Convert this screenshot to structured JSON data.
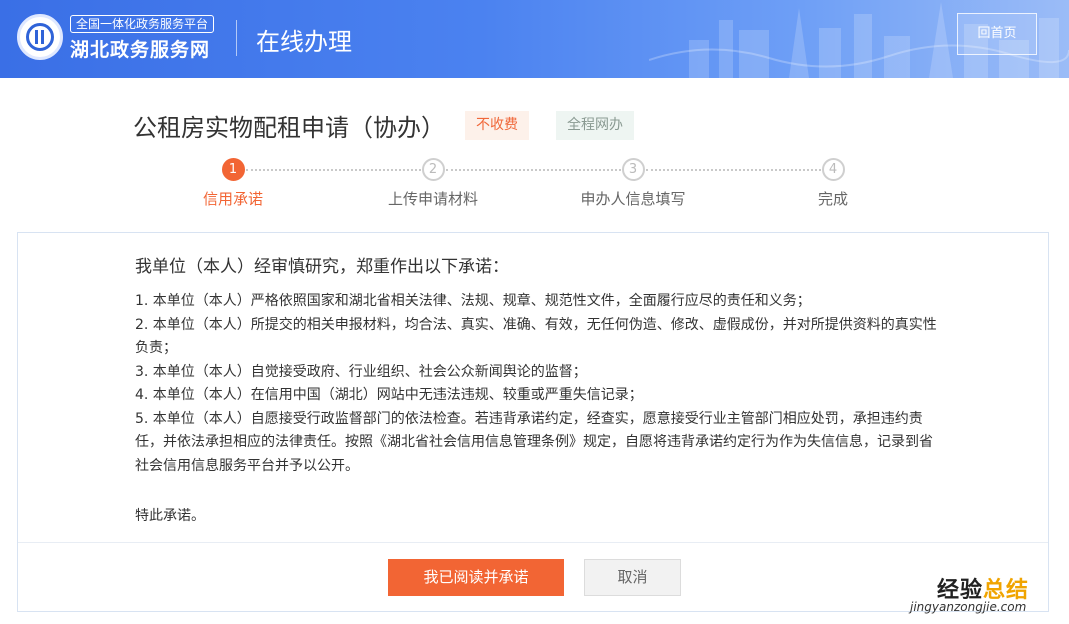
{
  "header": {
    "logo_top": "全国一体化政务服务平台",
    "logo_main": "湖北政务服务网",
    "section_title": "在线办理",
    "home_button": "回首页",
    "colors": {
      "start": "#3a6fe6",
      "end": "#9bbcf7"
    }
  },
  "service": {
    "title": "公租房实物配租申请（协办）",
    "tags": [
      "不收费",
      "全程网办"
    ]
  },
  "steps": [
    {
      "number": "1",
      "label": "信用承诺",
      "active": true
    },
    {
      "number": "2",
      "label": "上传申请材料",
      "active": false
    },
    {
      "number": "3",
      "label": "申办人信息填写",
      "active": false
    },
    {
      "number": "4",
      "label": "完成",
      "active": false
    }
  ],
  "pledge": {
    "title": "我单位（本人）经审慎研究，郑重作出以下承诺：",
    "items": [
      "1. 本单位（本人）严格依照国家和湖北省相关法律、法规、规章、规范性文件，全面履行应尽的责任和义务；",
      "2. 本单位（本人）所提交的相关申报材料，均合法、真实、准确、有效，无任何伪造、修改、虚假成份，并对所提供资料的真实性负责；",
      "3. 本单位（本人）自觉接受政府、行业组织、社会公众新闻舆论的监督；",
      "4. 本单位（本人）在信用中国（湖北）网站中无违法违规、较重或严重失信记录；",
      "5. 本单位（本人）自愿接受行政监督部门的依法检查。若违背承诺约定，经查实，愿意接受行业主管部门相应处罚，承担违约责任，并依法承担相应的法律责任。按照《湖北省社会信用信息管理条例》规定，自愿将违背承诺约定行为作为失信信息，记录到省社会信用信息服务平台并予以公开。"
    ],
    "closing": "特此承诺。"
  },
  "actions": {
    "agree": "我已阅读并承诺",
    "cancel": "取消"
  },
  "watermark": {
    "part1": "经验",
    "part2": "总结",
    "sub": "jingyanzongjie.com"
  },
  "colors": {
    "accent": "#f26534",
    "inactive": "#cfcfcf"
  },
  "icons": [
    "hubei-gov-logo-icon"
  ]
}
